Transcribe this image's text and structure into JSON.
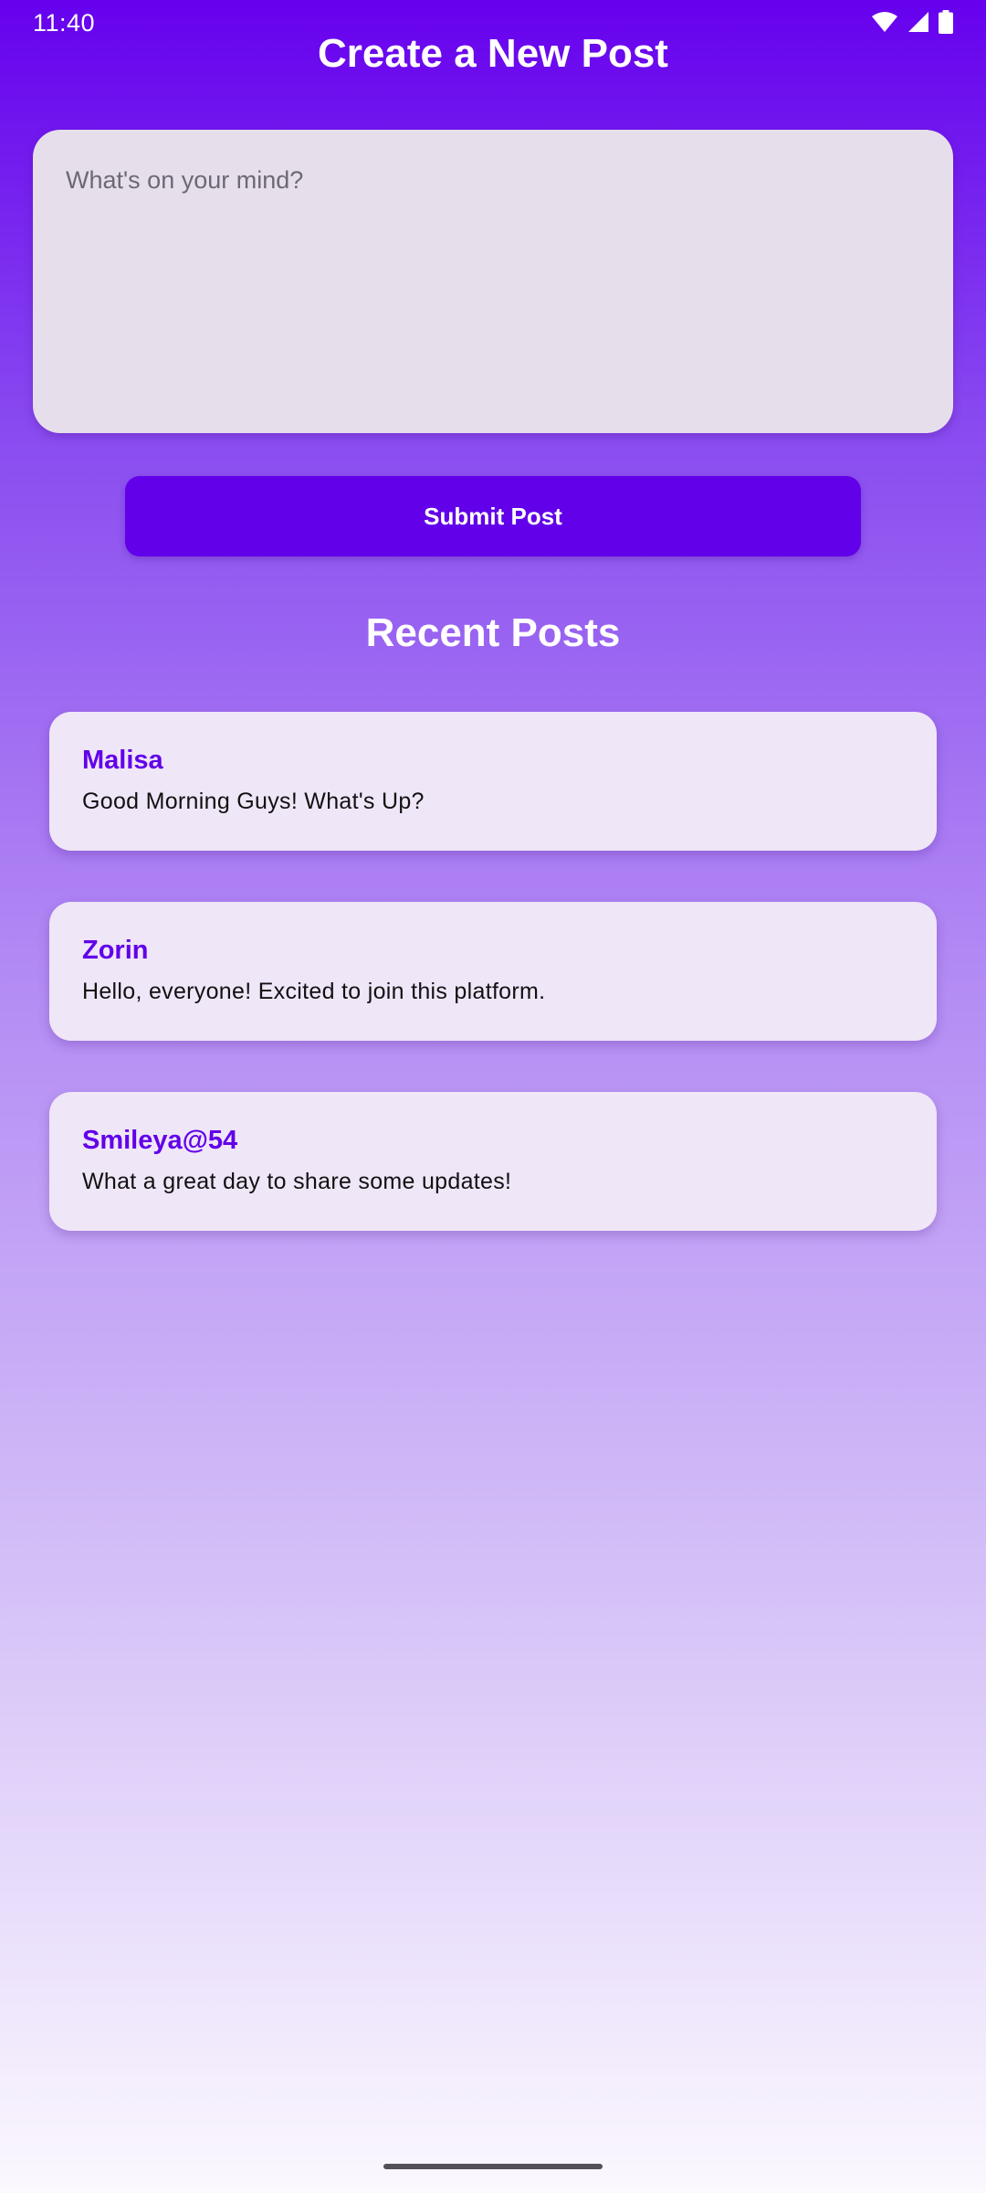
{
  "status_bar": {
    "time": "11:40",
    "icons": [
      "wifi-icon",
      "cell-signal-icon",
      "battery-icon"
    ],
    "color": "#ffffff"
  },
  "header": {
    "title": "Create a New Post"
  },
  "composer": {
    "value": "",
    "placeholder": "What's on your mind?",
    "submit_label": "Submit Post"
  },
  "recent": {
    "title": "Recent Posts",
    "posts": [
      {
        "author": "Malisa",
        "text": "Good Morning Guys! What's Up?"
      },
      {
        "author": "Zorin",
        "text": "Hello, everyone! Excited to join this platform."
      },
      {
        "author": "Smileya@54",
        "text": "What a great day to share some updates!"
      }
    ]
  },
  "colors": {
    "accent": "#6200ea",
    "card_background": "#efe6f8",
    "composer_background": "#e6dfeb"
  }
}
